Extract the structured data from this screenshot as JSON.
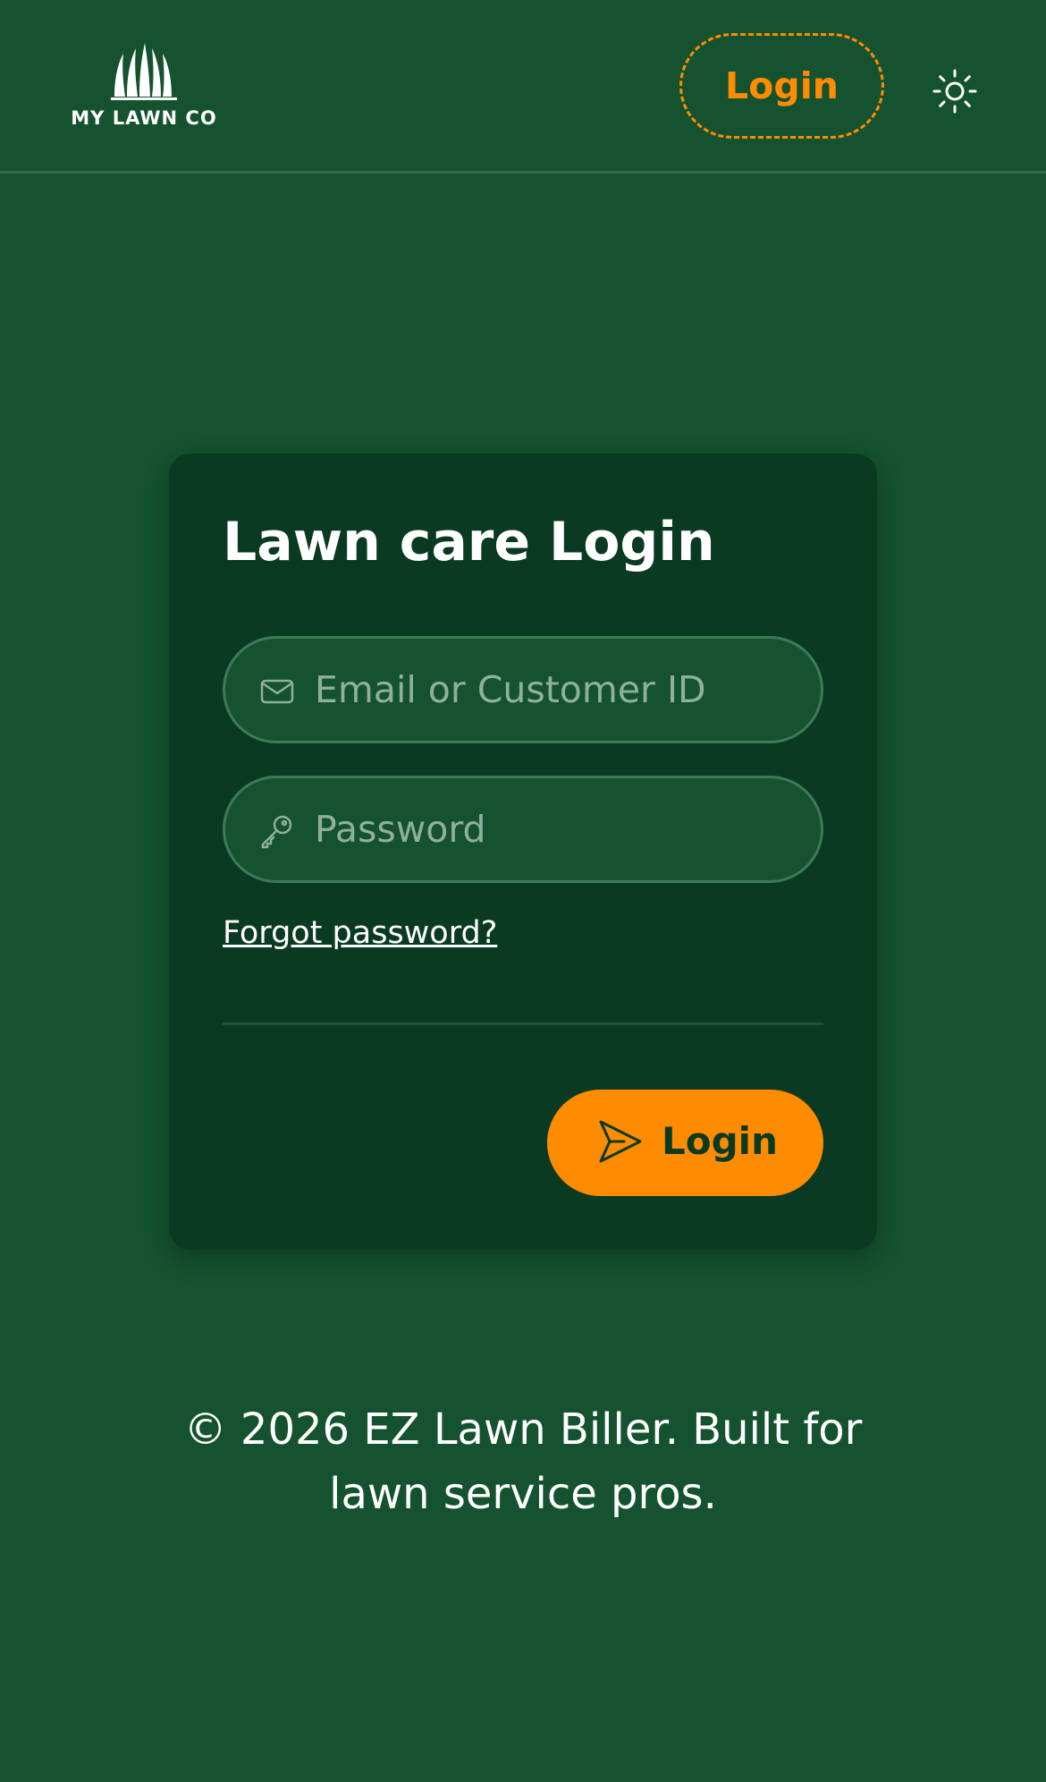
{
  "header": {
    "logo_text": "MY LAWN CO",
    "login_label": "Login",
    "theme_icon": "sun-icon"
  },
  "login_card": {
    "title": "Lawn care Login",
    "email_placeholder": "Email or Customer ID",
    "email_value": "",
    "email_icon": "mail-icon",
    "password_placeholder": "Password",
    "password_value": "",
    "password_icon": "key-icon",
    "forgot_password_label": "Forgot password?",
    "submit_label": "Login",
    "submit_icon": "send-icon"
  },
  "footer": {
    "line1": "© 2026 EZ Lawn Biller. Built for",
    "line2": "lawn service pros."
  },
  "colors": {
    "background": "#15522f",
    "card": "#0b3a22",
    "accent": "#ff8c00",
    "text": "#ffffff",
    "placeholder": "#8fb09c",
    "field_border": "#3f7a57"
  }
}
